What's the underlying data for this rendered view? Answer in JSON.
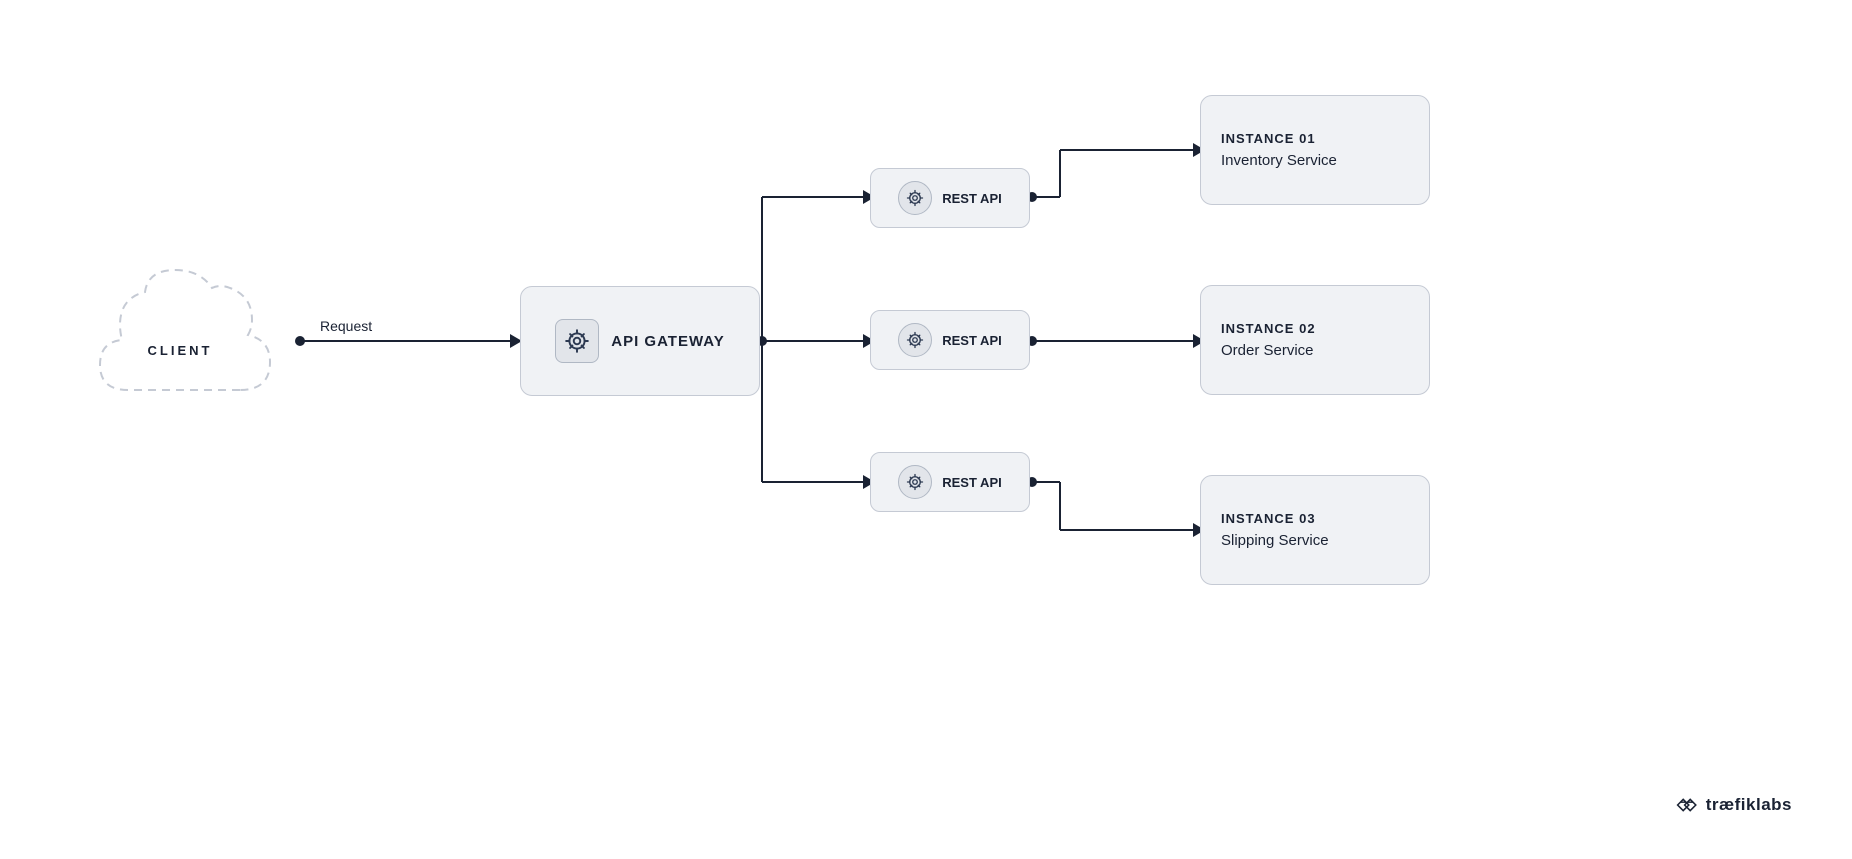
{
  "client": {
    "label": "CLIENT"
  },
  "request": {
    "label": "Request"
  },
  "gateway": {
    "label": "API GATEWAY"
  },
  "rest_apis": [
    {
      "label": "REST API",
      "id": "rest-1"
    },
    {
      "label": "REST API",
      "id": "rest-2"
    },
    {
      "label": "REST API",
      "id": "rest-3"
    }
  ],
  "instances": [
    {
      "number": "INSTANCE 01",
      "name": "Inventory Service",
      "id": "instance-1"
    },
    {
      "number": "INSTANCE 02",
      "name": "Order Service",
      "id": "instance-2"
    },
    {
      "number": "INSTANCE 03",
      "name": "Slipping Service",
      "id": "instance-3"
    }
  ],
  "brand": {
    "name": "træfiklabs",
    "symbol": "⇌"
  },
  "colors": {
    "bg": "#ffffff",
    "border": "#c5cad4",
    "box_bg": "#f0f2f5",
    "text": "#1a2233",
    "arrow": "#1a2233"
  }
}
